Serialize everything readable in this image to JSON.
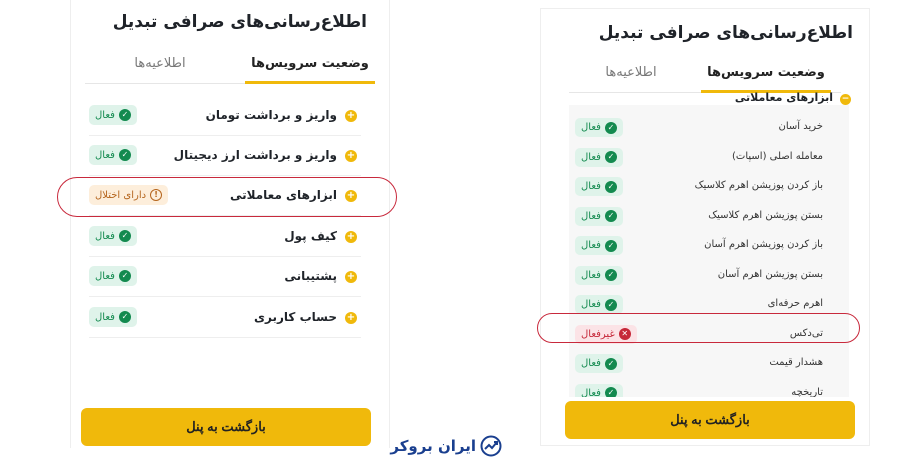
{
  "left_panel": {
    "title": "اطلاع‌رسانی‌های صرافی تبدیل",
    "tabs": {
      "active": "وضعیت سرویس‌ها",
      "inactive": "اطلاعیه‌ها"
    },
    "rows": [
      {
        "label": "واریز و برداشت تومان",
        "status": "فعال",
        "state": "ok"
      },
      {
        "label": "واریز و برداشت ارز دیجیتال",
        "status": "فعال",
        "state": "ok"
      },
      {
        "label": "ابزارهای معاملاتی",
        "status": "دارای اختلال",
        "state": "warn"
      },
      {
        "label": "کیف پول",
        "status": "فعال",
        "state": "ok"
      },
      {
        "label": "پشتیبانی",
        "status": "فعال",
        "state": "ok"
      },
      {
        "label": "حساب کاربری",
        "status": "فعال",
        "state": "ok"
      }
    ],
    "back_button": "بازگشت به پنل"
  },
  "right_panel": {
    "title": "اطلاع‌رسانی‌های صرافی تبدیل",
    "tabs": {
      "active": "وضعیت سرویس‌ها",
      "inactive": "اطلاعیه‌ها"
    },
    "section": "ابزارهای معاملاتی",
    "subrows": [
      {
        "label": "خرید آسان",
        "status": "فعال",
        "state": "ok"
      },
      {
        "label": "معامله اصلی (اسپات)",
        "status": "فعال",
        "state": "ok"
      },
      {
        "label": "باز کردن پوزیشن اهرم کلاسیک",
        "status": "فعال",
        "state": "ok"
      },
      {
        "label": "بستن پوزیشن اهرم کلاسیک",
        "status": "فعال",
        "state": "ok"
      },
      {
        "label": "باز کردن پوزیشن اهرم آسان",
        "status": "فعال",
        "state": "ok"
      },
      {
        "label": "بستن پوزیشن اهرم آسان",
        "status": "فعال",
        "state": "ok"
      },
      {
        "label": "اهرم حرفه‌ای",
        "status": "فعال",
        "state": "ok"
      },
      {
        "label": "تی‌دکس",
        "status": "غیرفعال",
        "state": "bad"
      },
      {
        "label": "هشدار قیمت",
        "status": "فعال",
        "state": "ok"
      },
      {
        "label": "تاریخچه",
        "status": "فعال",
        "state": "ok"
      }
    ],
    "back_button": "بازگشت به پنل"
  },
  "brand": {
    "name": "ایران بروکر"
  },
  "colors": {
    "accent": "#f0b90b",
    "ok": "#138a4f",
    "warn": "#b5651d",
    "bad": "#c62839",
    "highlight": "#c8293c",
    "brand": "#1a3f8f"
  },
  "icons": {
    "plus": "plus-icon",
    "minus": "minus-icon",
    "check": "check-icon",
    "warning": "warning-icon",
    "error": "close-icon",
    "logo": "chart-trend-icon"
  }
}
